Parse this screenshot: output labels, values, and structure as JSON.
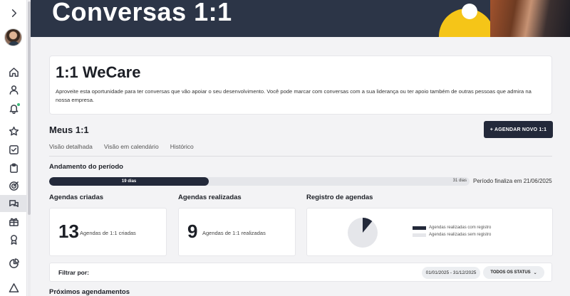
{
  "banner": {
    "title": "Conversas 1:1"
  },
  "sidebar": {
    "icons": [
      "chevron-right-icon",
      "home-icon",
      "user-icon",
      "bell-icon",
      "star-icon",
      "check-square-icon",
      "clipboard-icon",
      "target-icon",
      "chat-icon",
      "gift-icon",
      "award-icon",
      "pie-chart-icon",
      "warning-icon"
    ],
    "notification_dot_color": "#3cb878"
  },
  "intro": {
    "title": "1:1 WeCare",
    "text": "Aproveite esta oportunidade para ter conversas que vão apoiar o seu desenvolvimento. Você pode marcar com conversas com a sua liderança ou ter apoio também de outras pessoas que admira na nossa empresa."
  },
  "meus": {
    "title": "Meus 1:1",
    "new_button": "+ AGENDAR NOVO 1:1"
  },
  "tabs": [
    "Visão detalhada",
    "Visão em calendário",
    "Histórico"
  ],
  "period": {
    "title": "Andamento do período",
    "elapsed_label": "19 dias",
    "remaining_label": "31 dias",
    "elapsed_fraction": 0.38,
    "end_text": "Período finaliza em 21/06/2025"
  },
  "stats": {
    "created_title": "Agendas criadas",
    "created_value": "13",
    "created_label": "Agendas de 1:1 criadas",
    "done_title": "Agendas realizadas",
    "done_value": "9",
    "done_label": "Agendas de 1:1 realizadas",
    "registry_title": "Registro de agendas",
    "registry_fraction_with": 0.11,
    "legend_with": "Agendas realizadas com registro",
    "legend_without": "Agendas realizadas sem registro",
    "color_with": "#23293a",
    "color_without": "#e5e6ea"
  },
  "filter": {
    "label": "Filtrar por:",
    "date_range": "01/01/2025 - 31/12/2025",
    "status": "TODOS OS STATUS"
  },
  "upcoming": {
    "title": "Próximos agendamentos"
  },
  "colors": {
    "navy": "#23293a",
    "banner": "#2c3547",
    "accent_yellow": "#f5c518"
  }
}
